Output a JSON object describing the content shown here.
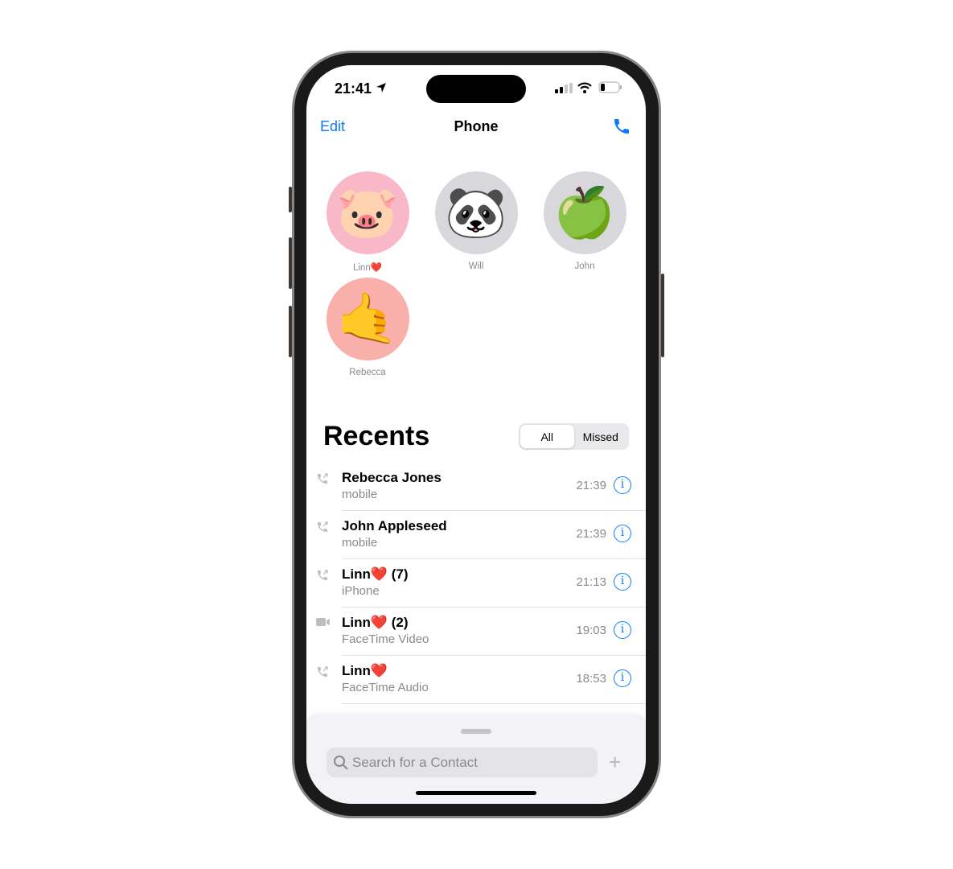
{
  "status": {
    "time": "21:41"
  },
  "nav": {
    "edit": "Edit",
    "title": "Phone"
  },
  "favorites": [
    {
      "name": "Linn❤️",
      "emoji": "🐷",
      "bg": "#f9b8c8"
    },
    {
      "name": "Will",
      "emoji": "🐼",
      "bg": "#d8d8dc"
    },
    {
      "name": "John",
      "emoji": "🍏",
      "bg": "#d8d8dc"
    },
    {
      "name": "Rebecca",
      "emoji": "🤙",
      "bg": "#f9b0aa"
    }
  ],
  "recents": {
    "title": "Recents",
    "seg_all": "All",
    "seg_missed": "Missed",
    "items": [
      {
        "name": "Rebecca Jones",
        "sub": "mobile",
        "time": "21:39",
        "icon": "phone-outgoing-icon"
      },
      {
        "name": "John Appleseed",
        "sub": "mobile",
        "time": "21:39",
        "icon": "phone-outgoing-icon"
      },
      {
        "name": "Linn❤️  (7)",
        "sub": "iPhone",
        "time": "21:13",
        "icon": "phone-outgoing-icon"
      },
      {
        "name": "Linn❤️  (2)",
        "sub": "FaceTime Video",
        "time": "19:03",
        "icon": "video-outgoing-icon"
      },
      {
        "name": "Linn❤️",
        "sub": "FaceTime Audio",
        "time": "18:53",
        "icon": "phone-outgoing-icon"
      }
    ]
  },
  "search": {
    "placeholder": "Search for a Contact"
  },
  "colors": {
    "accent": "#0a7aff"
  }
}
